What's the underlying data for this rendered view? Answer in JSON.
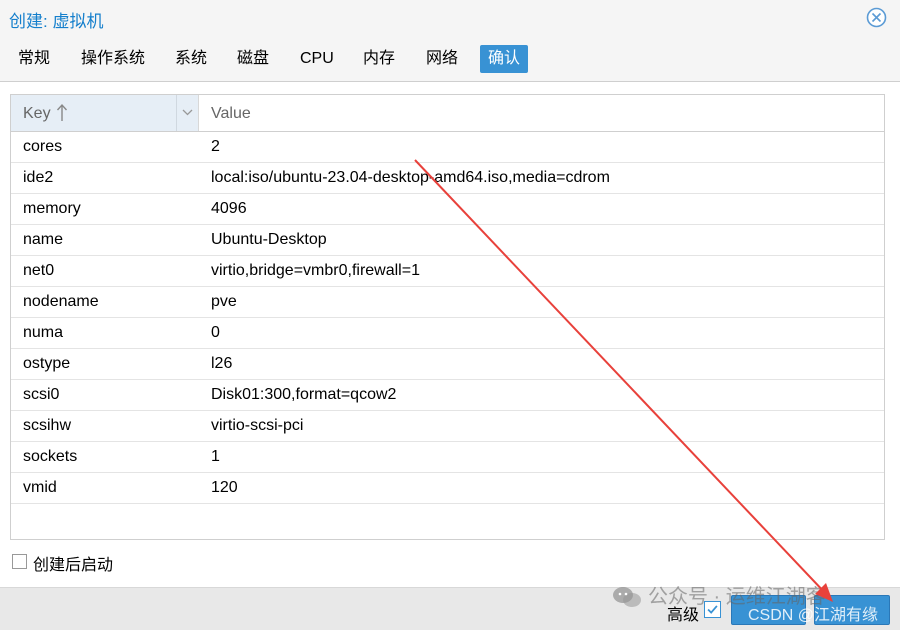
{
  "window": {
    "title": "创建: 虚拟机",
    "close_icon": "close-circle-icon"
  },
  "tabs": [
    {
      "label": "常规"
    },
    {
      "label": "操作系统"
    },
    {
      "label": "系统"
    },
    {
      "label": "磁盘"
    },
    {
      "label": "CPU"
    },
    {
      "label": "内存"
    },
    {
      "label": "网络"
    },
    {
      "label": "确认",
      "active": true
    }
  ],
  "grid": {
    "columns": {
      "key": "Key",
      "value": "Value"
    },
    "rows": [
      {
        "key": "cores",
        "value": "2"
      },
      {
        "key": "ide2",
        "value": "local:iso/ubuntu-23.04-desktop-amd64.iso,media=cdrom"
      },
      {
        "key": "memory",
        "value": "4096"
      },
      {
        "key": "name",
        "value": "Ubuntu-Desktop"
      },
      {
        "key": "net0",
        "value": "virtio,bridge=vmbr0,firewall=1"
      },
      {
        "key": "nodename",
        "value": "pve"
      },
      {
        "key": "numa",
        "value": "0"
      },
      {
        "key": "ostype",
        "value": "l26"
      },
      {
        "key": "scsi0",
        "value": "Disk01:300,format=qcow2"
      },
      {
        "key": "scsihw",
        "value": "virtio-scsi-pci"
      },
      {
        "key": "sockets",
        "value": "1"
      },
      {
        "key": "vmid",
        "value": "120"
      }
    ]
  },
  "start_after_create": {
    "label": "创建后启动",
    "checked": false
  },
  "footer": {
    "advanced_label": "高级",
    "advanced_checked": true
  },
  "watermark": {
    "text": "公众号 · 运维江湖客",
    "csdn": "CSDN @江湖有缘"
  },
  "colors": {
    "accent": "#3892d4",
    "title": "#157fcc",
    "arrow": "#e8413b"
  }
}
